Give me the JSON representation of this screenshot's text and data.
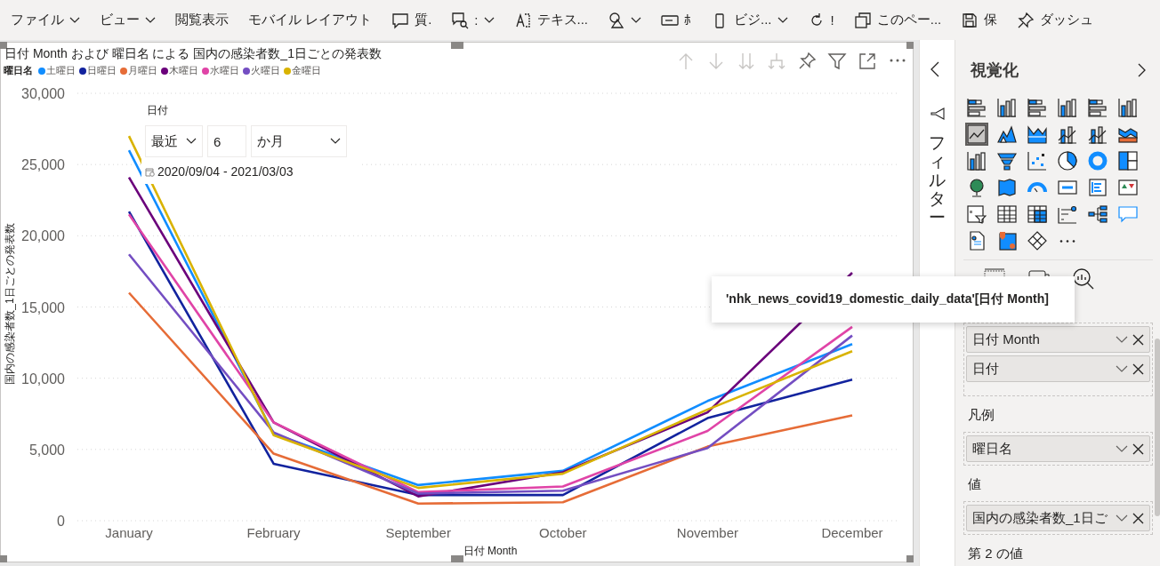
{
  "toolbar": [
    {
      "label": "ファイル",
      "menu": true
    },
    {
      "label": "ビュー",
      "menu": true
    },
    {
      "label": "閲覧表示",
      "menu": false
    },
    {
      "label": "モバイル レイアウト",
      "menu": false
    },
    {
      "kind": "comment",
      "label": "質.",
      "menu": false
    },
    {
      "kind": "qa",
      "label": ":",
      "menu": true
    },
    {
      "kind": "textbox",
      "label": "テキス...",
      "menu": false
    },
    {
      "kind": "shapes",
      "menu": true
    },
    {
      "kind": "button",
      "label": "ﾎ",
      "menu": false
    },
    {
      "kind": "mobile",
      "label": "ビジ...",
      "menu": true
    },
    {
      "kind": "refresh",
      "label": "!",
      "menu": false
    },
    {
      "kind": "copy",
      "label": "このペー...",
      "menu": false
    },
    {
      "kind": "save",
      "label": "保",
      "menu": false
    },
    {
      "kind": "pin",
      "label": "ダッシュ",
      "menu": false
    }
  ],
  "visual": {
    "legend_title": "曜日名",
    "chart_data": {
      "type": "line",
      "grid": true,
      "title": "日付 Month および 曜日名 による 国内の感染者数_1日ごとの発表数",
      "xlabel": "日付 Month",
      "ylabel": "国内の感染者数_1日ごとの発表数",
      "categories": [
        "January",
        "February",
        "September",
        "October",
        "November",
        "December"
      ],
      "ylim": [
        0,
        30000
      ],
      "yticks": [
        {
          "value": 0,
          "label": "0"
        },
        {
          "value": 5000,
          "label": "5,000"
        },
        {
          "value": 10000,
          "label": "10,000"
        },
        {
          "value": 15000,
          "label": "15,000"
        },
        {
          "value": 20000,
          "label": "20,000"
        },
        {
          "value": 25000,
          "label": "25,000"
        },
        {
          "value": 30000,
          "label": "30,000"
        }
      ],
      "series": [
        {
          "name": "土曜日",
          "color": "#118dff",
          "values": [
            26000,
            6100,
            2500,
            3500,
            8400,
            12400
          ]
        },
        {
          "name": "日曜日",
          "color": "#12239e",
          "values": [
            21700,
            4000,
            1800,
            1800,
            7200,
            9900
          ]
        },
        {
          "name": "月曜日",
          "color": "#e66c37",
          "values": [
            16000,
            4700,
            1200,
            1300,
            5200,
            7400
          ]
        },
        {
          "name": "木曜日",
          "color": "#6b007b",
          "values": [
            24100,
            6900,
            1700,
            3400,
            7600,
            17400
          ]
        },
        {
          "name": "水曜日",
          "color": "#e044a7",
          "values": [
            21500,
            6900,
            2000,
            2400,
            6300,
            13600
          ]
        },
        {
          "name": "火曜日",
          "color": "#744ec2",
          "values": [
            18700,
            6200,
            1900,
            2100,
            5100,
            13000
          ]
        },
        {
          "name": "金曜日",
          "color": "#d9b300",
          "values": [
            27000,
            6000,
            2300,
            3300,
            7800,
            11900
          ]
        }
      ]
    }
  },
  "slicer": {
    "label": "日付",
    "mode": "最近",
    "count": "6",
    "unit": "か月",
    "range": "2020/09/04 - 2021/03/03"
  },
  "tooltip": {
    "text": "'nhk_news_covid19_domestic_daily_data'[日付 Month]"
  },
  "filters": {
    "label": "フィルター"
  },
  "visualizations": {
    "title": "視覚化",
    "icons": [
      {
        "kind": "stacked-bar",
        "selected": false
      },
      {
        "kind": "stacked-column",
        "selected": false
      },
      {
        "kind": "clustered-bar",
        "selected": false
      },
      {
        "kind": "clustered-column",
        "selected": false
      },
      {
        "kind": "percent-bar",
        "selected": false
      },
      {
        "kind": "percent-column",
        "selected": false
      },
      {
        "kind": "line",
        "selected": true
      },
      {
        "kind": "area",
        "selected": false
      },
      {
        "kind": "stacked-area",
        "selected": false
      },
      {
        "kind": "line-column",
        "selected": false
      },
      {
        "kind": "line-clustered",
        "selected": false
      },
      {
        "kind": "ribbon",
        "selected": false
      },
      {
        "kind": "waterfall",
        "selected": false
      },
      {
        "kind": "funnel",
        "selected": false
      },
      {
        "kind": "scatter",
        "selected": false
      },
      {
        "kind": "pie",
        "selected": false
      },
      {
        "kind": "donut",
        "selected": false
      },
      {
        "kind": "treemap",
        "selected": false
      },
      {
        "kind": "globe",
        "selected": false
      },
      {
        "kind": "filled-map",
        "selected": false
      },
      {
        "kind": "gauge",
        "selected": false
      },
      {
        "kind": "card",
        "selected": false
      },
      {
        "kind": "multirow-card",
        "selected": false
      },
      {
        "kind": "kpi",
        "selected": false
      },
      {
        "kind": "slicer",
        "selected": false
      },
      {
        "kind": "table",
        "selected": false
      },
      {
        "kind": "matrix",
        "selected": false
      },
      {
        "kind": "influencers",
        "selected": false
      },
      {
        "kind": "tree",
        "selected": false
      },
      {
        "kind": "speech",
        "selected": false
      },
      {
        "kind": "document",
        "selected": false
      },
      {
        "kind": "map-pin",
        "selected": false
      },
      {
        "kind": "diamond",
        "selected": false
      },
      {
        "kind": "more",
        "selected": false
      }
    ]
  },
  "wells": [
    {
      "fields": [
        "日付 Month",
        "日付"
      ]
    },
    {
      "label": "凡例",
      "fields": [
        "曜日名"
      ]
    },
    {
      "label": "値",
      "fields": [
        "国内の感染者数_1日ご"
      ]
    },
    {
      "label": "第 2 の値"
    }
  ]
}
